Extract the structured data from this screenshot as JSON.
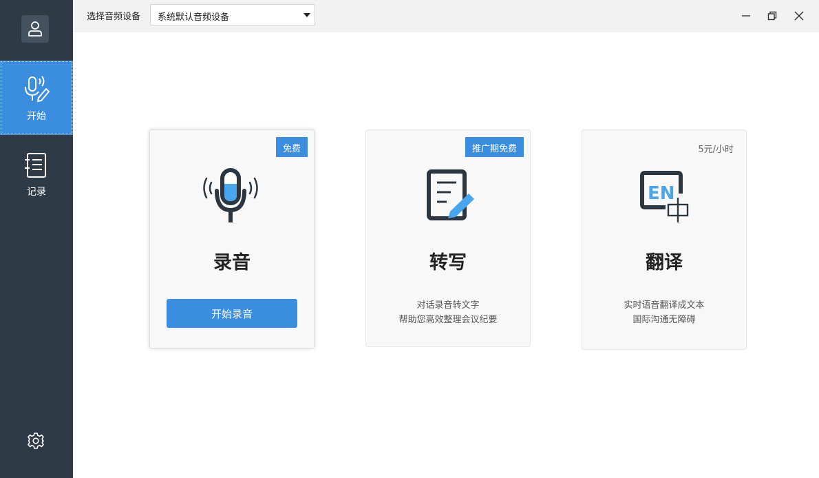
{
  "topbar": {
    "device_label": "选择音频设备",
    "device_selected": "系统默认音频设备"
  },
  "sidebar": {
    "items": [
      {
        "label": "开始",
        "icon": "microphone-pen-icon",
        "active": true
      },
      {
        "label": "记录",
        "icon": "notebook-icon",
        "active": false
      }
    ]
  },
  "cards": [
    {
      "title": "录音",
      "badge": "免费",
      "button": "开始录音",
      "icon": "microphone-icon"
    },
    {
      "title": "转写",
      "badge": "推广期免费",
      "desc_line1": "对话录音转文字",
      "desc_line2": "帮助您高效整理会议纪要",
      "icon": "document-edit-icon"
    },
    {
      "title": "翻译",
      "price": "5元/小时",
      "desc_line1": "实时语音翻译成文本",
      "desc_line2": "国际沟通无障碍",
      "icon": "translate-en-zh-icon"
    }
  ],
  "colors": {
    "sidebar": "#2e3a45",
    "accent": "#3b8de0",
    "topbar": "#f2f2f2",
    "card": "#f8f8f8"
  }
}
